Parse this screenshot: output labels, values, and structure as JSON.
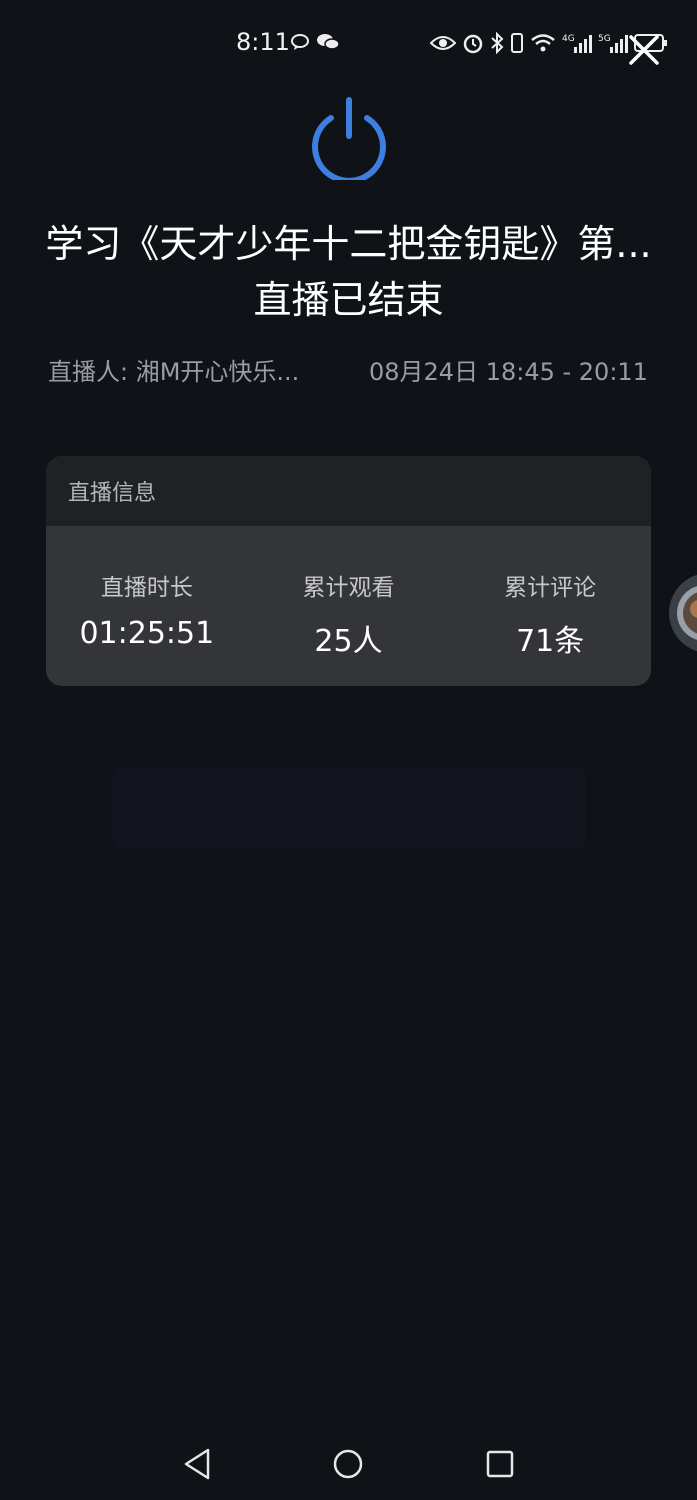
{
  "status_bar": {
    "time": "8:11",
    "icons_left": [
      "chat-bubble-icon",
      "wechat-icon"
    ],
    "icons_right": [
      "eye-icon",
      "alarm-icon",
      "bluetooth-icon",
      "phone-vibrate-icon",
      "wifi-icon",
      "signal-4g-icon",
      "signal-5g-icon",
      "battery-icon"
    ]
  },
  "live_end": {
    "title": "学习《天才少年十二把金钥匙》第...",
    "subtitle": "直播已结束",
    "host": "直播人: 湘M开心快乐...",
    "time_range": "08月24日 18:45 - 20:11"
  },
  "info_card": {
    "header": "直播信息",
    "stats": [
      {
        "label": "直播时长",
        "value": "01:25:51"
      },
      {
        "label": "累计观看",
        "value": "25人"
      },
      {
        "label": "累计评论",
        "value": "71条"
      }
    ]
  },
  "colors": {
    "background": "#0f1217",
    "accent": "#3d7fe0",
    "card": "#343538",
    "card_header": "#1f2125",
    "muted_text": "#9a9ca2"
  },
  "nav_bar": {
    "buttons": [
      "back-icon",
      "home-icon",
      "recents-icon"
    ]
  }
}
